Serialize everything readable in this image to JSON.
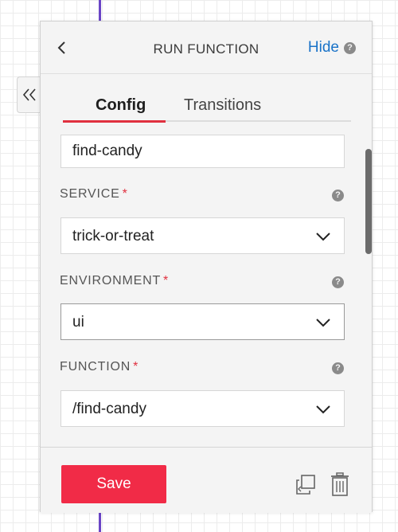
{
  "header": {
    "title": "RUN FUNCTION",
    "hide_label": "Hide",
    "help_glyph": "?"
  },
  "tabs": [
    {
      "label": "Config",
      "active": true
    },
    {
      "label": "Transitions",
      "active": false
    }
  ],
  "form": {
    "name_value": "find-candy",
    "required_marker": "*",
    "service": {
      "label": "SERVICE",
      "value": "trick-or-treat"
    },
    "environment": {
      "label": "ENVIRONMENT",
      "value": "ui"
    },
    "function": {
      "label": "FUNCTION",
      "value": "/find-candy"
    }
  },
  "footer": {
    "save_label": "Save"
  },
  "icons": {
    "collapse": "chevrons-left-icon",
    "back": "chevron-left-icon",
    "help": "help-circle-icon",
    "dropdown": "chevron-down-icon",
    "duplicate": "duplicate-icon",
    "delete": "trash-icon"
  },
  "colors": {
    "accent": "#e0303f",
    "save_button": "#f12b47",
    "link": "#1a73c8",
    "canvas_line": "#6a45c6"
  }
}
